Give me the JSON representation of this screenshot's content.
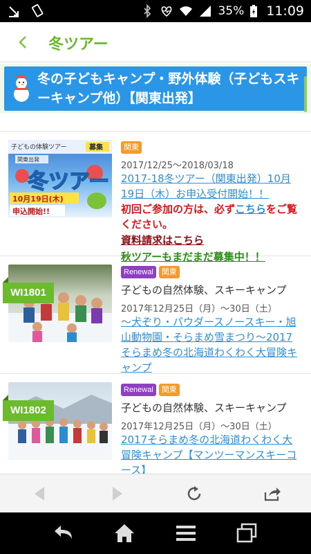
{
  "status_bar": {
    "battery_percent": "35%",
    "time": "11:09",
    "icons": [
      "download-icon",
      "vibrate-icon",
      "bluetooth-icon",
      "heart-monitor-icon",
      "wifi-icon",
      "signal-icon",
      "battery-charging-icon"
    ]
  },
  "app_bar": {
    "title": "冬ツアー",
    "back_icon": "chevron-left-icon"
  },
  "banner": {
    "icon": "snowman-icon",
    "title": "冬の子どもキャンプ・野外体験（子どもスキーキャンプ他）【関東出発】"
  },
  "items": [
    {
      "thumb_alt": "冬ツアー 10月19日(木) 申込開始!!",
      "thumb_text_top": "子どもの体験ツアー",
      "thumb_text_sub": "関東出発",
      "thumb_text_recruit": "募集",
      "thumb_text_main": "冬ツアー",
      "thumb_text_date": "10月19日(木)",
      "thumb_text_start": "申込開始!!",
      "badges": [
        "関東"
      ],
      "date": "2017/12/25〜2018/03/18",
      "link": "2017-18冬ツアー（関東出発）10月19日（木）お申込受付開始！！",
      "notice_before": "初回ご参加の方は、必ず",
      "notice_link": "こちら",
      "notice_after": "をご覧ください。",
      "request_link": "資料請求はこちら",
      "autumn_link": "秋ツアーもまだまだ募集中！！"
    },
    {
      "code": "WI1801",
      "badges": [
        "Renewal",
        "関東"
      ],
      "category": "子どもの自然体験、スキーキャンプ",
      "date": "2017年12月25日（月）〜30日（土）",
      "link": "〜犬ぞり・パウダースノースキー・旭山動物園・そらまめ雪まつり〜2017そらまめ冬の北海道わくわく大冒険キャンプ"
    },
    {
      "code": "WI1802",
      "badges": [
        "Renewal",
        "関東"
      ],
      "category": "子どもの自然体験、スキーキャンプ",
      "date": "2017年12月25日（月）〜30日（土）",
      "link": "2017そらまめ冬の北海道わくわく大冒険キャンプ【マンツーマンスキーコース】"
    }
  ],
  "browser_toolbar": {
    "icons": [
      "back-arrow-icon",
      "forward-arrow-icon",
      "reload-icon",
      "share-icon"
    ]
  },
  "nav_bar": {
    "icons": [
      "back-icon",
      "home-icon",
      "menu-icon",
      "recent-apps-icon"
    ]
  },
  "colors": {
    "brand_green": "#6ab82c",
    "banner_blue": "#2c96e6",
    "link_blue": "#2d8fd8",
    "notice_red": "#d8161b",
    "region_badge": "#f39a2b",
    "renewal_badge": "#8e3fc3"
  }
}
